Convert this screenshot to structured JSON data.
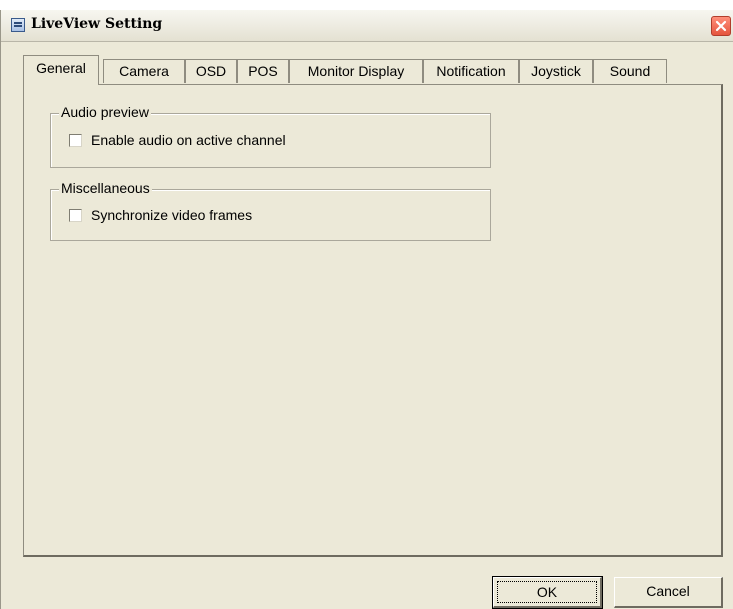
{
  "window": {
    "title": "LiveView Setting",
    "icons": {
      "app": "settings-window-icon",
      "close": "close-x-icon"
    }
  },
  "tabs": [
    {
      "label": "General",
      "active": true
    },
    {
      "label": "Camera",
      "active": false
    },
    {
      "label": "OSD",
      "active": false
    },
    {
      "label": "POS",
      "active": false
    },
    {
      "label": "Monitor Display",
      "active": false
    },
    {
      "label": "Notification",
      "active": false
    },
    {
      "label": "Joystick",
      "active": false
    },
    {
      "label": "Sound",
      "active": false
    }
  ],
  "groups": {
    "audio_preview": {
      "title": "Audio preview",
      "option": {
        "label": "Enable audio on active channel",
        "checked": false
      }
    },
    "miscellaneous": {
      "title": "Miscellaneous",
      "option": {
        "label": "Synchronize video frames",
        "checked": false
      }
    }
  },
  "buttons": {
    "ok": "OK",
    "cancel": "Cancel"
  },
  "colors": {
    "dialog_bg": "#ece9d8",
    "close_button": "#e5553e"
  }
}
